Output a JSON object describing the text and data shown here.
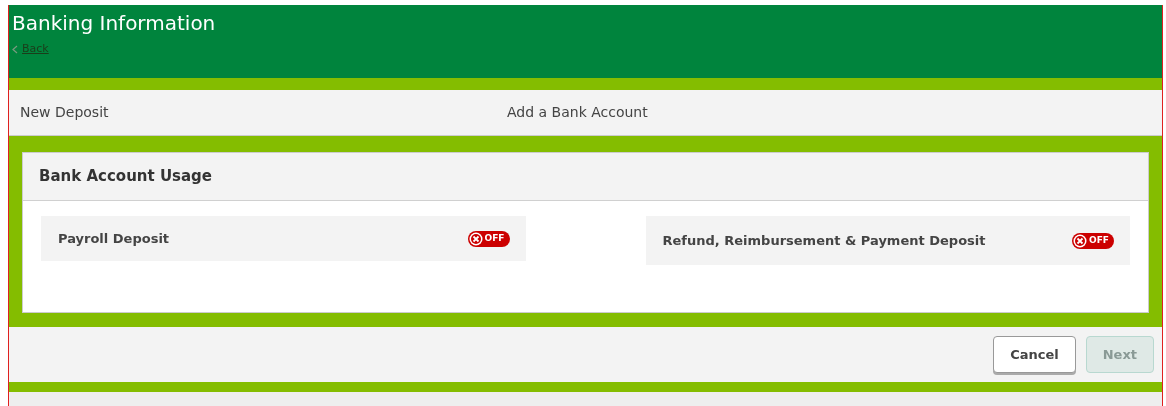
{
  "header": {
    "title": "Banking Information",
    "back_link": "Back"
  },
  "steps": [
    {
      "label": "New Deposit"
    },
    {
      "label": "Add a Bank Account"
    }
  ],
  "card": {
    "title": "Bank Account Usage",
    "options": [
      {
        "label": "Payroll Deposit",
        "on": false,
        "toggle_text": "OFF"
      },
      {
        "label": "Refund, Reimbursement & Payment Deposit",
        "on": false,
        "toggle_text": "OFF"
      }
    ]
  },
  "buttons": [
    {
      "label": "Cancel",
      "disabled": false
    },
    {
      "label": "Next",
      "disabled": true
    }
  ]
}
